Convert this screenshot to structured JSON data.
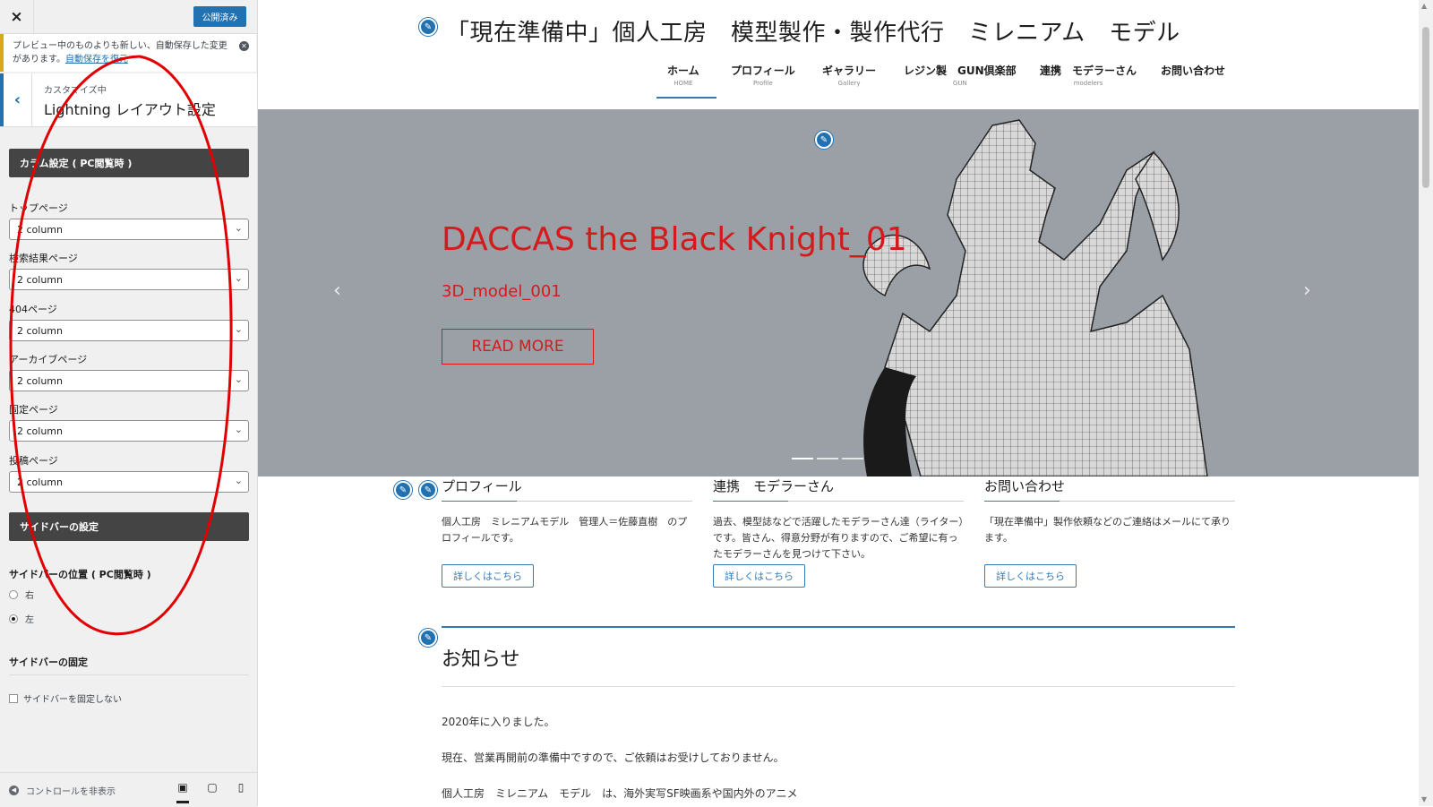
{
  "customizer": {
    "close_icon": "×",
    "publish_label": "公開済み",
    "notice_text": "プレビュー中のものよりも新しい、自動保存した変更があります。",
    "notice_link": "自動保存を復元",
    "section_small": "カスタマイズ中",
    "section_title": "Lightning レイアウト設定",
    "column_header": "カラム設定 ( PC閲覧時 )",
    "fields": [
      {
        "label": "トップページ",
        "value": "2 column"
      },
      {
        "label": "検索結果ページ",
        "value": "2 column"
      },
      {
        "label": "404ページ",
        "value": "2 column"
      },
      {
        "label": "アーカイブページ",
        "value": "2 column"
      },
      {
        "label": "固定ページ",
        "value": "2 column"
      },
      {
        "label": "投稿ページ",
        "value": "2 column"
      }
    ],
    "sidebar_header": "サイドバーの設定",
    "sidebar_pos_label": "サイドバーの位置 ( PC閲覧時 )",
    "radio_right": "右",
    "radio_left": "左",
    "sidebar_fixed_title": "サイドバーの固定",
    "sidebar_fixed_check": "サイドバーを固定しない",
    "hide_controls": "コントロールを非表示"
  },
  "site": {
    "title": "「現在準備中」個人工房　模型製作・製作代行　ミレニアム　モデル",
    "nav": [
      {
        "jp": "ホーム",
        "en": "HOME"
      },
      {
        "jp": "プロフィール",
        "en": "Profile"
      },
      {
        "jp": "ギャラリー",
        "en": "Gallery"
      },
      {
        "jp": "レジン製　GUN倶楽部",
        "en": "GUN"
      },
      {
        "jp": "連携　モデラーさん",
        "en": "modelers"
      },
      {
        "jp": "お問い合わせ",
        "en": ""
      }
    ],
    "hero": {
      "title": "DACCAS the Black Knight_01",
      "subtitle": "3D_model_001",
      "button": "READ MORE",
      "prev": "‹",
      "next": "›"
    },
    "cards": [
      {
        "title": "プロフィール",
        "text": "個人工房　ミレニアムモデル　管理人＝佐藤直樹　のプロフィールです。",
        "button": "詳しくはこちら"
      },
      {
        "title": "連携　モデラーさん",
        "text": "過去、模型誌などで活躍したモデラーさん達（ライター）です。皆さん、得意分野が有りますので、ご希望に有ったモデラーさんを見つけて下さい。",
        "button": "詳しくはこちら"
      },
      {
        "title": "お問い合わせ",
        "text": "「現在準備中」製作依頼などのご連絡はメールにて承ります。",
        "button": "詳しくはこちら"
      }
    ],
    "news_title": "お知らせ",
    "news_paragraphs": [
      "2020年に入りました。",
      "現在、営業再開前の準備中ですので、ご依頼はお受けしておりません。",
      "個人工房　ミレニアム　モデル　は、海外実写SF映画系や国内外のアニメ"
    ]
  },
  "colors": {
    "accent": "#2271b1",
    "hero_text": "#d41a1a",
    "hero_bg": "#9ba0a7",
    "annotation": "#e00000"
  }
}
